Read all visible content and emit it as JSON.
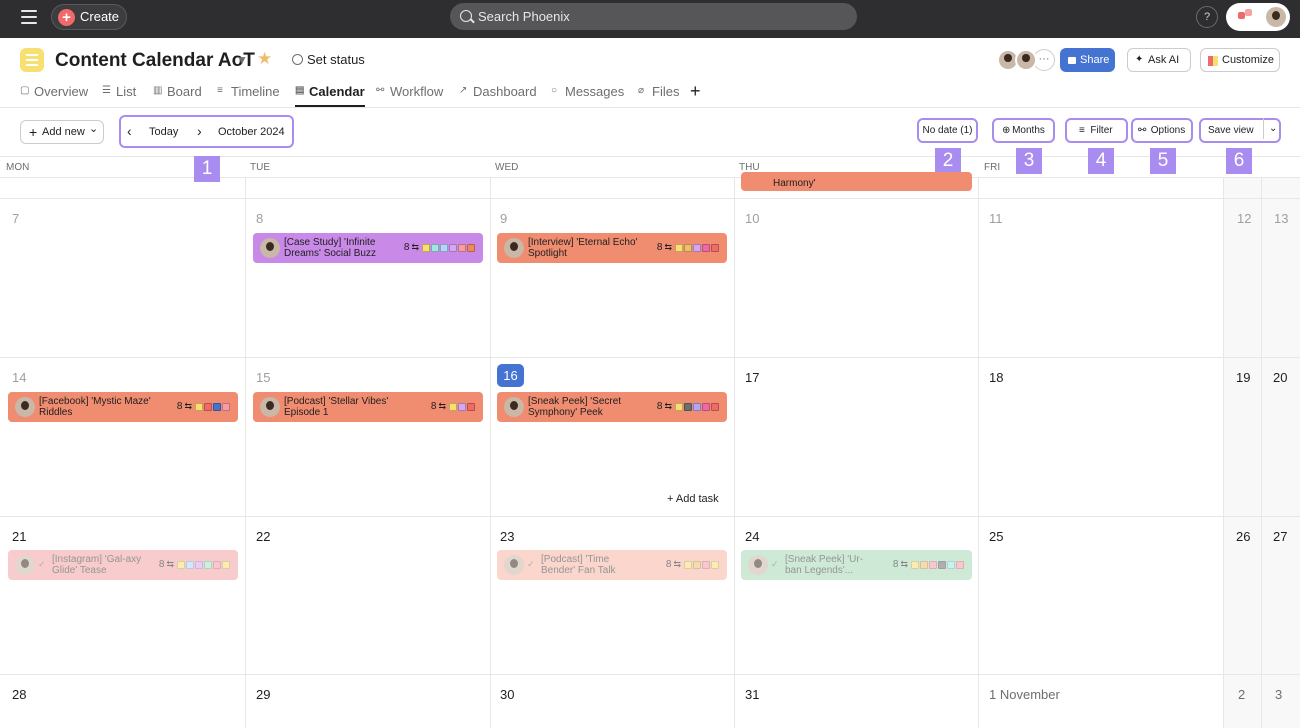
{
  "topbar": {
    "create_label": "Create",
    "search_placeholder": "Search Phoenix",
    "help_label": "?"
  },
  "header": {
    "project_title": "Content Calendar AoT",
    "set_status": "Set status",
    "more_members": "···",
    "share": "Share",
    "ask_ai": "Ask AI",
    "customize": "Customize",
    "tabs": [
      {
        "label": "Overview",
        "icon": "overview-icon"
      },
      {
        "label": "List",
        "icon": "list-icon"
      },
      {
        "label": "Board",
        "icon": "board-icon"
      },
      {
        "label": "Timeline",
        "icon": "timeline-icon"
      },
      {
        "label": "Calendar",
        "icon": "calendar-icon",
        "active": true
      },
      {
        "label": "Workflow",
        "icon": "workflow-icon"
      },
      {
        "label": "Dashboard",
        "icon": "dashboard-icon"
      },
      {
        "label": "Messages",
        "icon": "messages-icon"
      },
      {
        "label": "Files",
        "icon": "files-icon"
      }
    ]
  },
  "toolbar": {
    "add_new": "Add new",
    "today": "Today",
    "month": "October 2024",
    "no_date": "No date (1)",
    "months": "Months",
    "filter": "Filter",
    "options": "Options",
    "save_view": "Save view",
    "markers": [
      "1",
      "2",
      "3",
      "4",
      "5",
      "6"
    ]
  },
  "calendar": {
    "weekdays": [
      "MON",
      "TUE",
      "WED",
      "THU",
      "FRI"
    ],
    "partial_task": "Harmony'",
    "days": [
      "7",
      "8",
      "9",
      "10",
      "11",
      "12",
      "13",
      "14",
      "15",
      "16",
      "17",
      "18",
      "19",
      "20",
      "21",
      "22",
      "23",
      "24",
      "25",
      "26",
      "27",
      "28",
      "29",
      "30",
      "31",
      "1 November",
      "2",
      "3"
    ],
    "add_task": "Add task",
    "tasks": [
      {
        "title": "[Case Study] 'Infinite Dreams' Social Buzz",
        "subtasks": "8",
        "color": "#c989e6"
      },
      {
        "title": "[Interview] 'Eternal Echo' Spotlight",
        "subtasks": "8",
        "color": "#f08c6f"
      },
      {
        "title": "[Facebook] 'Mystic Maze' Riddles",
        "subtasks": "8",
        "color": "#f08c6f"
      },
      {
        "title": "[Podcast] 'Stellar Vibes' Episode 1",
        "subtasks": "8",
        "color": "#f08c6f"
      },
      {
        "title": "[Sneak Peek] 'Secret Symphony' Peek",
        "subtasks": "8",
        "color": "#f08c6f"
      },
      {
        "title": "[Instagram] 'Gal-axy Glide' Tease",
        "subtasks": "8",
        "color": "#f4a3a3"
      },
      {
        "title": "[Podcast] 'Time Bender' Fan Talk",
        "subtasks": "8",
        "color": "#f6b6a3"
      },
      {
        "title": "[Sneak Peek] 'Ur-ban Legends'...",
        "subtasks": "8",
        "color": "#a8d8b8"
      }
    ]
  }
}
